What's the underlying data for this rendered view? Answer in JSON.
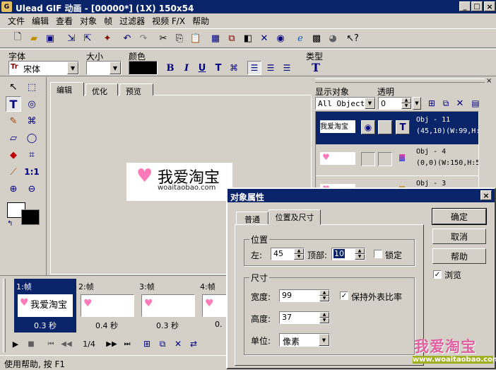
{
  "window": {
    "title": "Ulead GIF 动画 - [00000*] (1X) 150x54",
    "controls": [
      "_",
      "□",
      "×"
    ]
  },
  "menu": [
    "文件",
    "编辑",
    "查看",
    "对象",
    "帧",
    "过滤器",
    "视频 F/X",
    "帮助"
  ],
  "format_bar": {
    "font_label": "字体",
    "font_value": "宋体",
    "size_label": "大小",
    "size_value": "",
    "color_label": "颜色",
    "type_label": "类型",
    "color": "#000000"
  },
  "canvas_tabs": [
    "编辑",
    "优化",
    "预览"
  ],
  "canvas": {
    "logo_main": "我爱淘宝",
    "logo_url": "woaitaobao.com"
  },
  "object_panel": {
    "show_label": "显示对象",
    "show_value": "All Objects",
    "opacity_label": "透明",
    "opacity_value": "0",
    "objects": [
      {
        "name": "Obj - 11",
        "info": "(45,10)(W:99,H:",
        "thumb": "我爱淘宝"
      },
      {
        "name": "Obj - 4",
        "info": "(0,0)(W:150,H:5",
        "thumb": ""
      },
      {
        "name": "Obj - 3",
        "info": "",
        "thumb": ""
      }
    ]
  },
  "frames": [
    {
      "label": "1:帧",
      "delay": "0.3 秒",
      "thumb": "我爱淘宝"
    },
    {
      "label": "2:帧",
      "delay": "0.4 秒",
      "thumb": ""
    },
    {
      "label": "3:帧",
      "delay": "0.3 秒",
      "thumb": ""
    },
    {
      "label": "4:帧",
      "delay": "0.",
      "thumb": ""
    }
  ],
  "playback": {
    "counter": "1/4"
  },
  "status": "使用帮助, 按 F1",
  "dialog": {
    "title": "对象属性",
    "tabs": [
      "普通",
      "位置及尺寸"
    ],
    "position_group": "位置",
    "left_label": "左:",
    "left_value": "45",
    "top_label": "顶部:",
    "top_value": "10",
    "lock_label": "锁定",
    "size_group": "尺寸",
    "width_label": "宽度:",
    "width_value": "99",
    "keep_ratio_label": "保持外表比率",
    "height_label": "高度:",
    "height_value": "37",
    "unit_label": "单位:",
    "unit_value": "像素",
    "ok": "确定",
    "cancel": "取消",
    "help": "帮助",
    "browse_label": "浏览"
  },
  "watermark": {
    "main": "我爱淘宝",
    "url": "www.woaitaobao.com"
  }
}
